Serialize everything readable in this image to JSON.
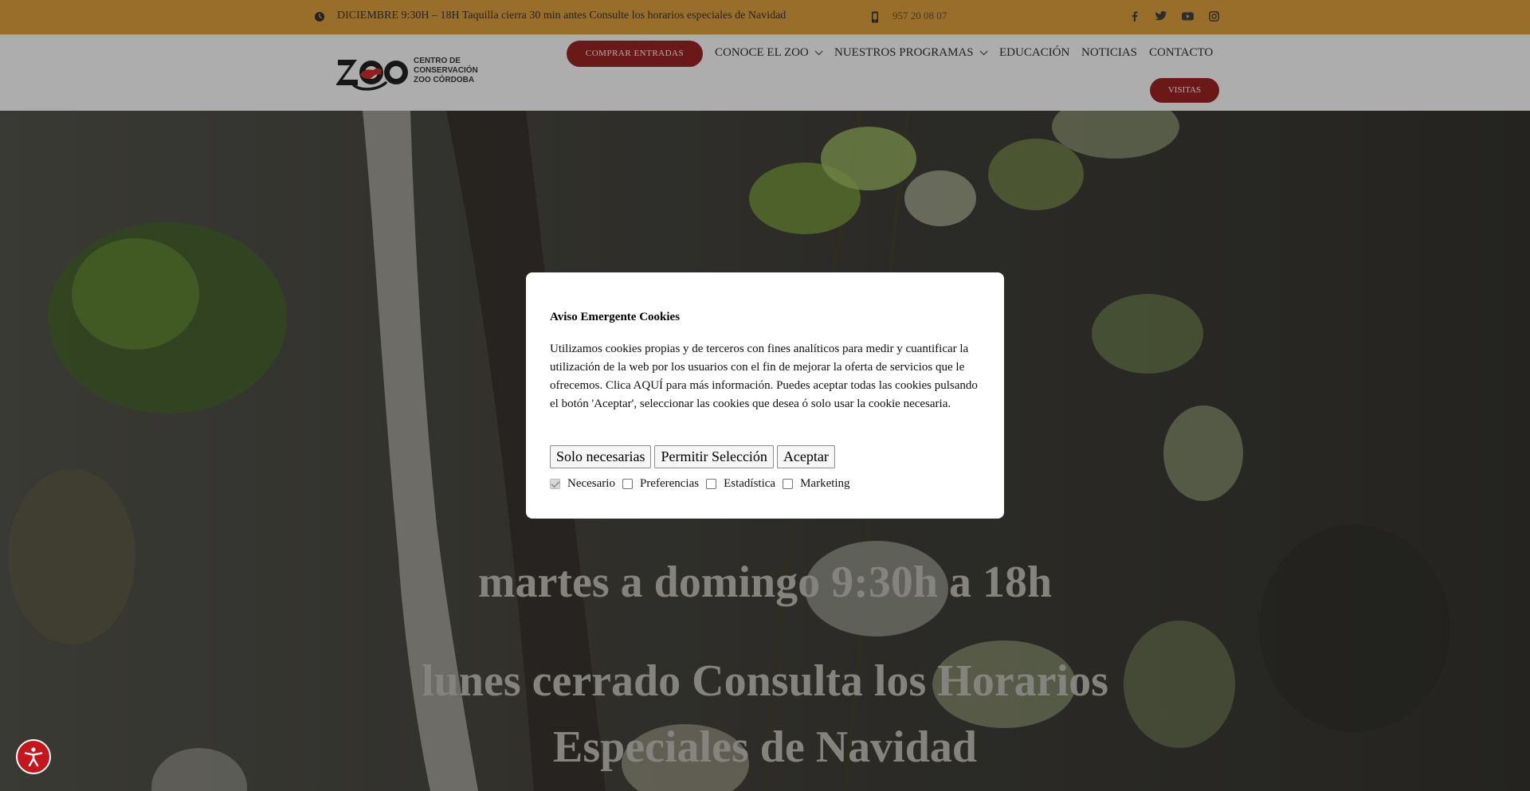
{
  "topbar": {
    "schedule_text": "DICIEMBRE 9:30H – 18H Taquilla cierra 30 min antes Consulte los horarios especiales de Navidad",
    "phone": "957 20 08 07",
    "social": [
      "facebook-icon",
      "twitter-icon",
      "youtube-icon",
      "instagram-icon"
    ],
    "background": "#c48e36"
  },
  "header": {
    "logo_text": [
      "CENTRO DE",
      "CONSERVACIÓN",
      "ZOO CÓRDOBA"
    ],
    "logo_word": "ZOO",
    "buy_button": "COMPRAR ENTRADAS",
    "nav": [
      {
        "label": "CONOCE EL ZOO",
        "dropdown": true
      },
      {
        "label": "NUESTROS PROGRAMAS",
        "dropdown": true
      },
      {
        "label": "EDUCACIÓN",
        "dropdown": false
      },
      {
        "label": "NOTICIAS",
        "dropdown": false
      },
      {
        "label": "CONTACTO",
        "dropdown": false
      }
    ],
    "visitas_button": "VISITAS",
    "accent": "#8a1f1f"
  },
  "hero": {
    "line1": "martes a domingo 9:30h a 18h",
    "line2": "lunes cerrado Consulta los Horarios",
    "line3": "Especiales de Navidad"
  },
  "cookie_modal": {
    "title": "Aviso Emergente Cookies",
    "body": "Utilizamos cookies propias y de terceros con fines analíticos para medir y cuantificar la utilización de la web por los usuarios con el fin de mejorar la oferta de servicios que le ofrecemos. Clica AQUÍ para más información. Puedes aceptar todas las cookies pulsando el botón 'Aceptar', seleccionar las cookies que desea ó solo usar la cookie necesaria.",
    "buttons": {
      "only_necessary": "Solo necesarias",
      "allow_selection": "Permitir Selección",
      "accept": "Aceptar"
    },
    "options": [
      {
        "label": "Necesario",
        "checked": true,
        "disabled": true
      },
      {
        "label": "Preferencias",
        "checked": false
      },
      {
        "label": "Estadística",
        "checked": false
      },
      {
        "label": "Marketing",
        "checked": false
      }
    ]
  },
  "accessibility_button": "accessibility-icon"
}
